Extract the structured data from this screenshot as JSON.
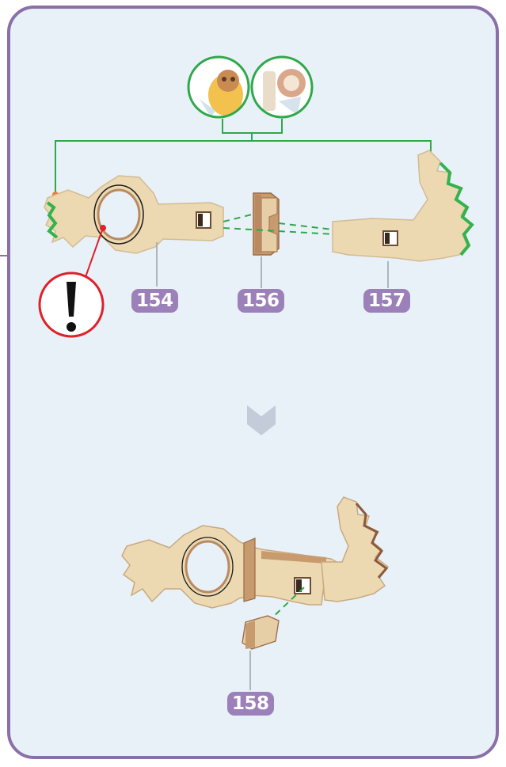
{
  "step": {
    "parts": [
      {
        "id": "part-154",
        "label": "154"
      },
      {
        "id": "part-156",
        "label": "156"
      },
      {
        "id": "part-157",
        "label": "157"
      },
      {
        "id": "part-158",
        "label": "158"
      }
    ],
    "warning_icon": "exclamation-icon",
    "next_indicator_icon": "chevron-down-icon",
    "reference_thumbnails": [
      "lion-face-thumbnail",
      "lion-side-thumbnail"
    ]
  },
  "colors": {
    "frame": "#8a6fa8",
    "panel_background": "#e8f1f8",
    "label_background": "#9b80b9",
    "leader_green": "#2ea84a",
    "alert_red": "#e0202a",
    "wood": "#ecd9b2",
    "wood_edge": "#b98a62"
  }
}
